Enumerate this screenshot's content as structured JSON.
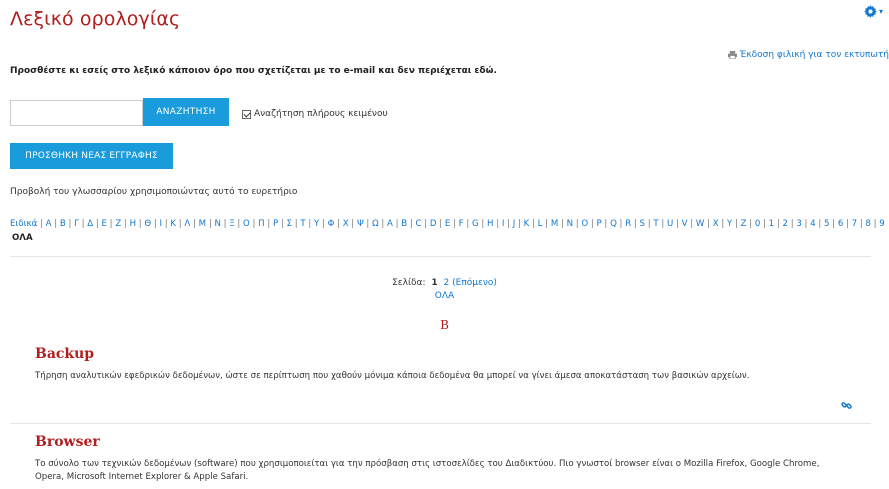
{
  "header": {
    "title": "Λεξικό ορολογίας",
    "printer_friendly": "Έκδοση φιλική για τον εκτυπωτή"
  },
  "add_term_note": "Προσθέστε κι εσείς στο λεξικό κάποιον όρο που σχετίζεται με το e-mail και δεν περιέχεται εδώ.",
  "search": {
    "value": "",
    "button": "ΑΝΑΖΗΤΗΣΗ",
    "fulltext_label": "Αναζήτηση πλήρους κειμένου",
    "fulltext_checked": true
  },
  "add_entry_button": "ΠΡΟΣΘΗΚΗ ΝΕΑΣ ΕΓΓΡΑΦΗΣ",
  "index_label": "Προβολή του γλωσσαρίου χρησιμοποιώντας αυτό το ευρετήριο",
  "alphabet": [
    "Ειδικά",
    "Α",
    "Β",
    "Γ",
    "Δ",
    "Ε",
    "Ζ",
    "Η",
    "Θ",
    "Ι",
    "Κ",
    "Λ",
    "Μ",
    "Ν",
    "Ξ",
    "Ο",
    "Π",
    "Ρ",
    "Σ",
    "Τ",
    "Υ",
    "Φ",
    "Χ",
    "Ψ",
    "Ω",
    "A",
    "B",
    "C",
    "D",
    "E",
    "F",
    "G",
    "H",
    "I",
    "J",
    "K",
    "L",
    "M",
    "N",
    "O",
    "P",
    "Q",
    "R",
    "S",
    "T",
    "U",
    "V",
    "W",
    "X",
    "Y",
    "Z",
    "0",
    "1",
    "2",
    "3",
    "4",
    "5",
    "6",
    "7",
    "8",
    "9"
  ],
  "alphabet_all": "ΟΛΑ",
  "paging": {
    "label": "Σελίδα:",
    "current": "1",
    "next_page": "2",
    "next_label": "(Επόμενο)",
    "all": "ΟΛΑ"
  },
  "section_letter": "B",
  "entries": [
    {
      "term": "Backup",
      "definition": "Τήρηση αναλυτικών εφεδρικών δεδομένων, ώστε σε περίπτωση που χαθούν μόνιμα κάποια δεδομένα θα μπορεί να γίνει άμεσα αποκατάσταση των βασικών αρχείων."
    },
    {
      "term": "Browser",
      "definition_line1": "Το σύνολο των τεχνικών δεδομένων (software) που χρησιμοποιείται για την πρόσβαση στις ιστοσελίδες του Διαδικτύου. Πιο γνωστοί browser είναι ο Mozilla Firefox, Google Chrome,",
      "definition_line2": "Opera, Microsoft Internet Explorer & Apple Safari."
    }
  ],
  "colors": {
    "title": "#b01e1e",
    "link": "#1177d1",
    "button": "#1a9bdc"
  }
}
